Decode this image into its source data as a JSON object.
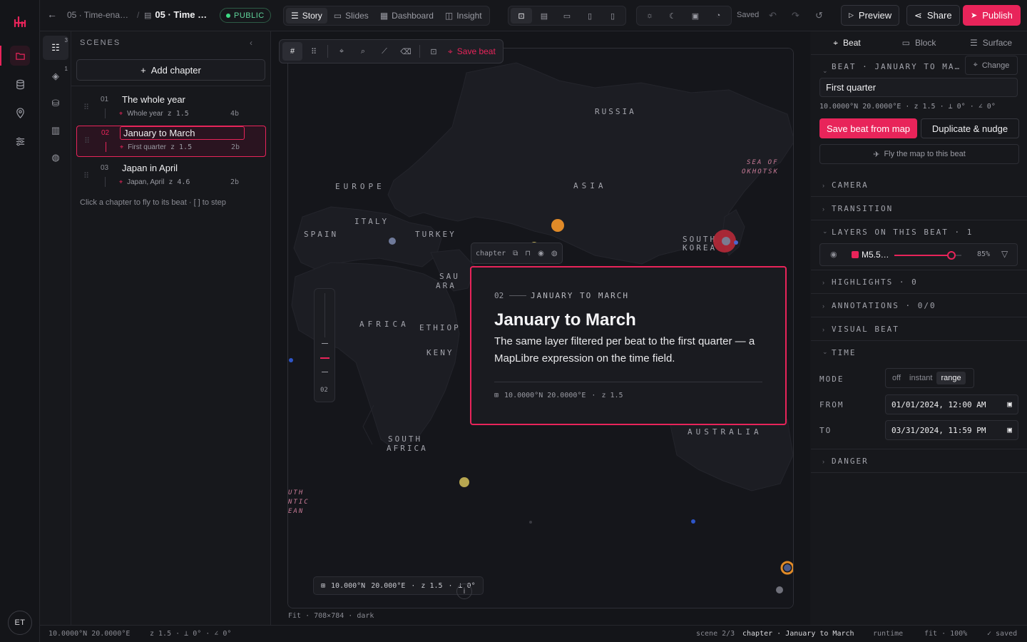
{
  "rail": {
    "avatar": "ET"
  },
  "topbar": {
    "crumb_parent": "05 · Time-ena…",
    "crumb_sep": "/",
    "crumb_current": "05 · Time …",
    "status_badge": "PUBLIC",
    "modes": [
      {
        "label": "Story"
      },
      {
        "label": "Slides"
      },
      {
        "label": "Dashboard"
      },
      {
        "label": "Insight"
      }
    ],
    "saved": "Saved",
    "preview": "Preview",
    "share": "Share",
    "publish": "Publish"
  },
  "scenes": {
    "tab_badges": [
      "3",
      "1"
    ],
    "heading": "SCENES",
    "add_chapter": "Add chapter",
    "chapters": [
      {
        "num": "01",
        "title": "The whole year",
        "beat": "Whole year",
        "zoom": "z 1.5",
        "beats": "4b"
      },
      {
        "num": "02",
        "title": "January to March",
        "beat": "First quarter",
        "zoom": "z 1.5",
        "beats": "2b"
      },
      {
        "num": "03",
        "title": "Japan in April",
        "beat": "Japan, April",
        "zoom": "z 4.6",
        "beats": "2b"
      }
    ],
    "hint": "Click a chapter to fly to its beat · [ ] to step"
  },
  "map": {
    "save_beat": "Save beat",
    "labels": {
      "russia": "RUSSIA",
      "europe": "EUROPE",
      "asia": "ASIA",
      "italy": "ITALY",
      "spain": "SPAIN",
      "turkey": "TURKEY",
      "sau": "SAU",
      "ara": "ARA",
      "africa": "AFRICA",
      "ethiopia": "ETHIOP",
      "kenya": "KENY",
      "south_africa_1": "SOUTH",
      "south_africa_2": "AFRICA",
      "australia": "AUSTRALIA",
      "south_korea_1": "SOUTH",
      "south_korea_2": "KOREA",
      "okhotsk_1": "SEA OF",
      "okhotsk_2": "OKHOTSK",
      "atlantic_1": "UTH",
      "atlantic_2": "NTIC",
      "atlantic_3": "EAN",
      "w": "W"
    },
    "zoom_level": "02",
    "coord_pill": {
      "lat": "10.000°N",
      "lon": "20.000°E",
      "zoom": "z 1.5",
      "tilt": "⊥ 0°"
    },
    "chapter_tool": "chapter",
    "card": {
      "num": "02",
      "eyebrow": "JANUARY TO MARCH",
      "title": "January to March",
      "body": "The same layer filtered per beat to the first quarter — a MapLibre expression on the time field.",
      "coords": "10.0000°N 20.0000°E",
      "zoom": "z 1.5"
    },
    "footer": "Fit · 708×784 · dark"
  },
  "panel": {
    "tabs": [
      "Beat",
      "Block",
      "Surface"
    ],
    "beat_heading": "BEAT · JANUARY TO MA…",
    "change": "Change",
    "beat_name": "First quarter",
    "beat_meta": "10.0000°N 20.0000°E · z 1.5 · ⊥ 0° · ∠ 0°",
    "save_from_map": "Save beat from map",
    "duplicate": "Duplicate & nudge",
    "fly": "Fly the map to this beat",
    "camera": "CAMERA",
    "transition": "TRANSITION",
    "layers": "LAYERS ON THIS BEAT · 1",
    "layer": {
      "name": "M5.5…",
      "opacity": "85%",
      "opacity_value": 0.85,
      "color": "#e8245a"
    },
    "highlights": "HIGHLIGHTS · 0",
    "annotations": "ANNOTATIONS · 0/0",
    "visual_beat": "VISUAL BEAT",
    "time": "TIME",
    "mode_label": "MODE",
    "modes": [
      "off",
      "instant",
      "range"
    ],
    "from_label": "FROM",
    "from_value": "01/01/2024, 12:00 AM",
    "to_label": "TO",
    "to_value": "03/31/2024, 11:59 PM",
    "danger": "DANGER"
  },
  "status": {
    "coords": "10.0000°N 20.0000°E",
    "view": "z 1.5 · ⊥ 0° · ∠ 0°",
    "scene": "scene 2/3",
    "chapter": "chapter · January to March",
    "runtime": "runtime",
    "fit": "fit · 100%",
    "saved": "✓ saved"
  },
  "colors": {
    "accent": "#e8245a",
    "public": "#3ddc84"
  }
}
